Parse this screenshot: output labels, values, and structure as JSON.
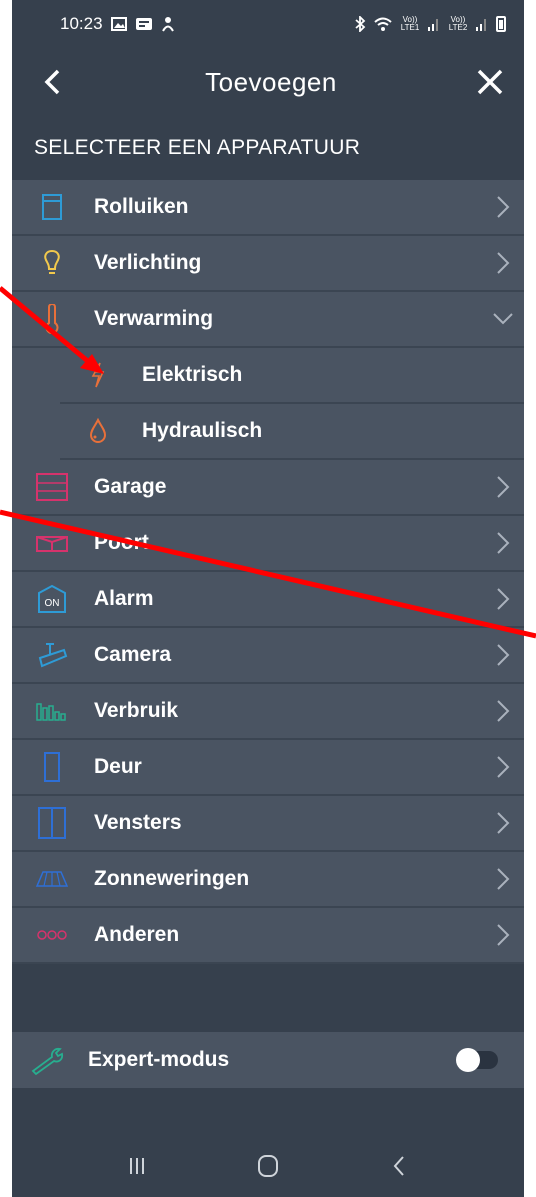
{
  "status_bar": {
    "time": "10:23",
    "left_icons": [
      "image-icon",
      "notification-icon",
      "gesture-icon"
    ],
    "right_icons": [
      "bluetooth-icon",
      "wifi-icon",
      "signal-lte1-icon",
      "signal-lte2-icon",
      "battery-icon"
    ],
    "lte1": "Vo)) LTE1",
    "lte2": "Vo)) LTE2"
  },
  "header": {
    "title": "Toevoegen",
    "back_icon": "chevron-left-icon",
    "close_icon": "close-icon"
  },
  "section_title": "SELECTEER EEN APPARATUUR",
  "devices": [
    {
      "label": "Rolluiken",
      "icon": "shutter-icon",
      "color": "#2e9bd6",
      "state": "collapsed"
    },
    {
      "label": "Verlichting",
      "icon": "lightbulb-icon",
      "color": "#f2c94c",
      "state": "collapsed"
    },
    {
      "label": "Verwarming",
      "icon": "thermometer-icon",
      "color": "#e8703a",
      "state": "expanded"
    },
    {
      "label": "Elektrisch",
      "icon": "lightning-icon",
      "color": "#e8703a",
      "sub": true
    },
    {
      "label": "Hydraulisch",
      "icon": "water-drop-icon",
      "color": "#e8703a",
      "sub": true
    },
    {
      "label": "Garage",
      "icon": "garage-icon",
      "color": "#d6336c",
      "state": "collapsed"
    },
    {
      "label": "Poort",
      "icon": "gate-icon",
      "color": "#d6336c",
      "state": "collapsed"
    },
    {
      "label": "Alarm",
      "icon": "alarm-icon",
      "color": "#2e9bd6",
      "state": "collapsed"
    },
    {
      "label": "Camera",
      "icon": "camera-icon",
      "color": "#2e9bd6",
      "state": "collapsed"
    },
    {
      "label": "Verbruik",
      "icon": "consumption-icon",
      "color": "#27ae8f",
      "state": "collapsed"
    },
    {
      "label": "Deur",
      "icon": "door-icon",
      "color": "#2e6fd6",
      "state": "collapsed"
    },
    {
      "label": "Vensters",
      "icon": "window-icon",
      "color": "#2e6fd6",
      "state": "collapsed"
    },
    {
      "label": "Zonneweringen",
      "icon": "awning-icon",
      "color": "#2e6fd6",
      "state": "collapsed"
    },
    {
      "label": "Anderen",
      "icon": "others-icon",
      "color": "#d6336c",
      "state": "collapsed"
    }
  ],
  "alarm_icon_text": "ON",
  "expert": {
    "label": "Expert-modus",
    "icon": "wrench-icon",
    "enabled": false
  },
  "nav_bar": {
    "recents_icon": "recents-icon",
    "home_icon": "home-icon",
    "back_icon": "back-icon"
  },
  "colors": {
    "background": "#36404d",
    "row": "#4a5462",
    "annotation": "#ff0000"
  }
}
